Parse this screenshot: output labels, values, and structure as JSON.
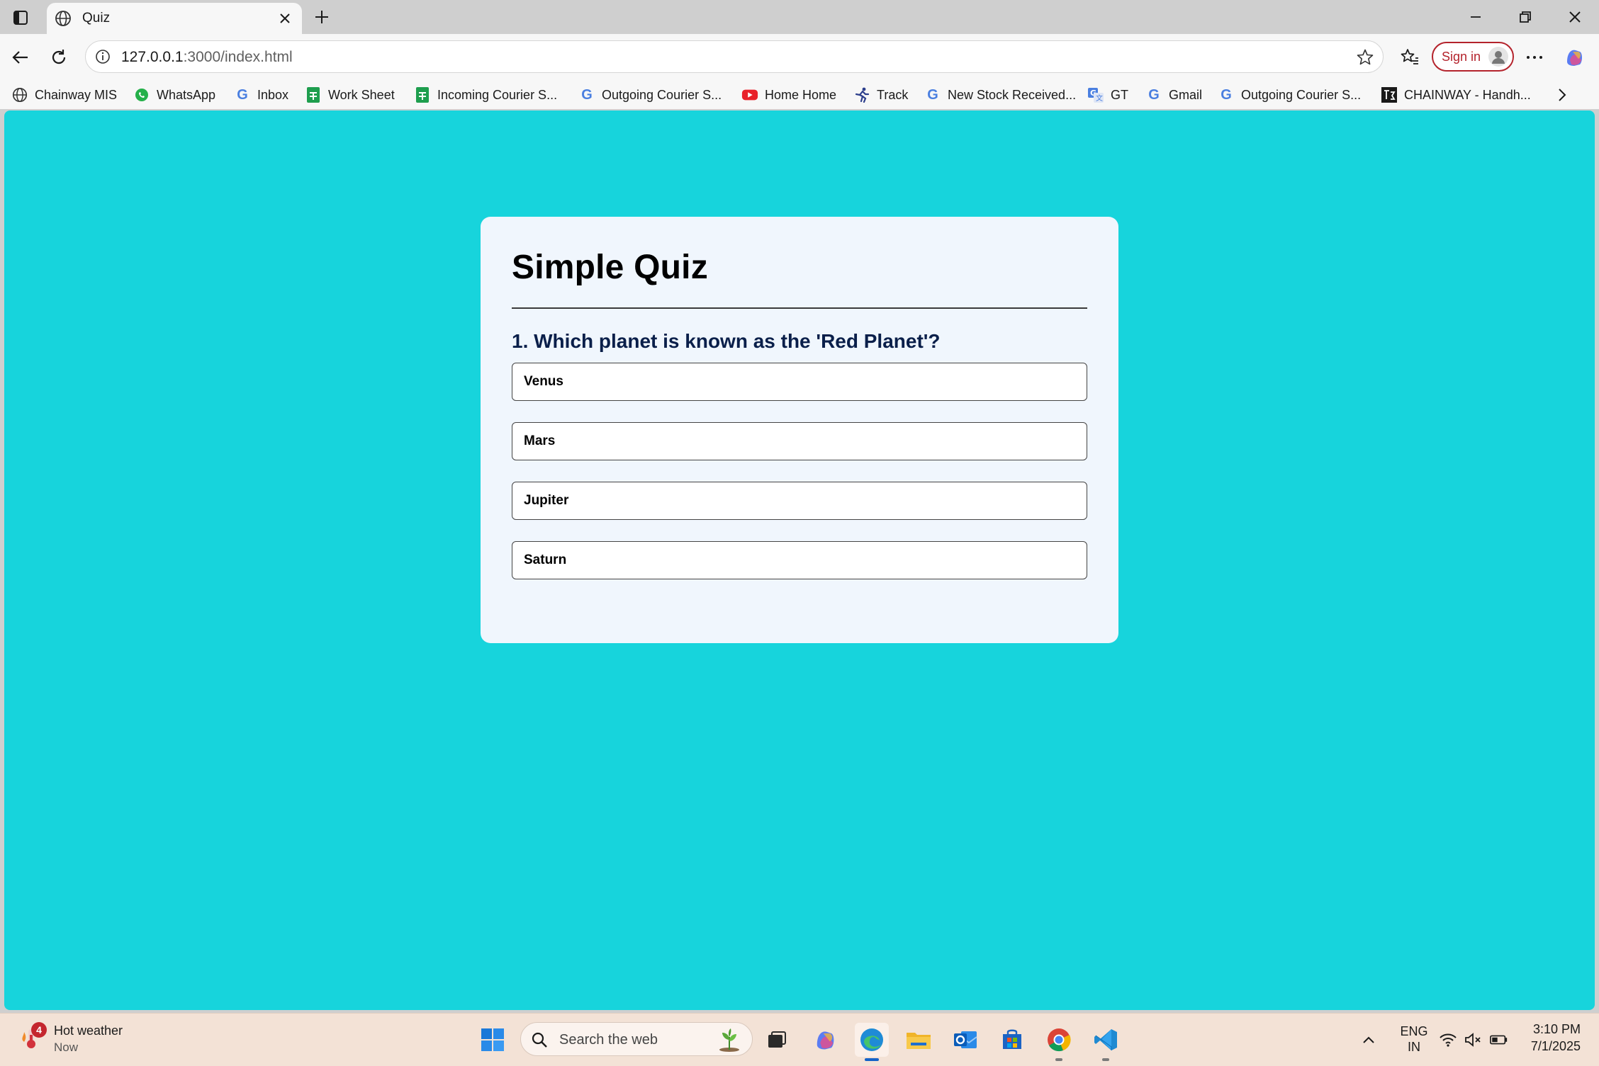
{
  "browser": {
    "tab_title": "Quiz",
    "url_host": "127.0.0.1",
    "url_path": ":3000/index.html",
    "signin_label": "Sign in"
  },
  "bookmarks": [
    {
      "label": "Chainway MIS",
      "icon": "globe-icon"
    },
    {
      "label": "WhatsApp",
      "icon": "whatsapp-icon"
    },
    {
      "label": "Inbox",
      "icon": "google-icon"
    },
    {
      "label": "Work Sheet",
      "icon": "sheets-icon"
    },
    {
      "label": "Incoming Courier S...",
      "icon": "sheets-icon"
    },
    {
      "label": "Outgoing Courier S...",
      "icon": "google-icon"
    },
    {
      "label": "Home Home",
      "icon": "youtube-icon"
    },
    {
      "label": "Track",
      "icon": "runner-icon"
    },
    {
      "label": "New Stock Received...",
      "icon": "google-icon"
    },
    {
      "label": "GT",
      "icon": "translate-icon"
    },
    {
      "label": "Gmail",
      "icon": "google-icon"
    },
    {
      "label": "Outgoing Courier S...",
      "icon": "google-icon"
    },
    {
      "label": "CHAINWAY - Handh...",
      "icon": "chainway-icon"
    }
  ],
  "quiz": {
    "title": "Simple Quiz",
    "question": "1. Which planet is known as the 'Red Planet'?",
    "answers": [
      "Venus",
      "Mars",
      "Jupiter",
      "Saturn"
    ]
  },
  "taskbar": {
    "weather_title": "Hot weather",
    "weather_sub": "Now",
    "weather_badge": "4",
    "search_placeholder": "Search the web",
    "lang_line1": "ENG",
    "lang_line2": "IN",
    "time": "3:10 PM",
    "date": "7/1/2025"
  },
  "colors": {
    "page_background": "#17d4dc",
    "card_background": "#f0f6fd",
    "question_text": "#0a1f4a",
    "signin_accent": "#b4232c"
  }
}
